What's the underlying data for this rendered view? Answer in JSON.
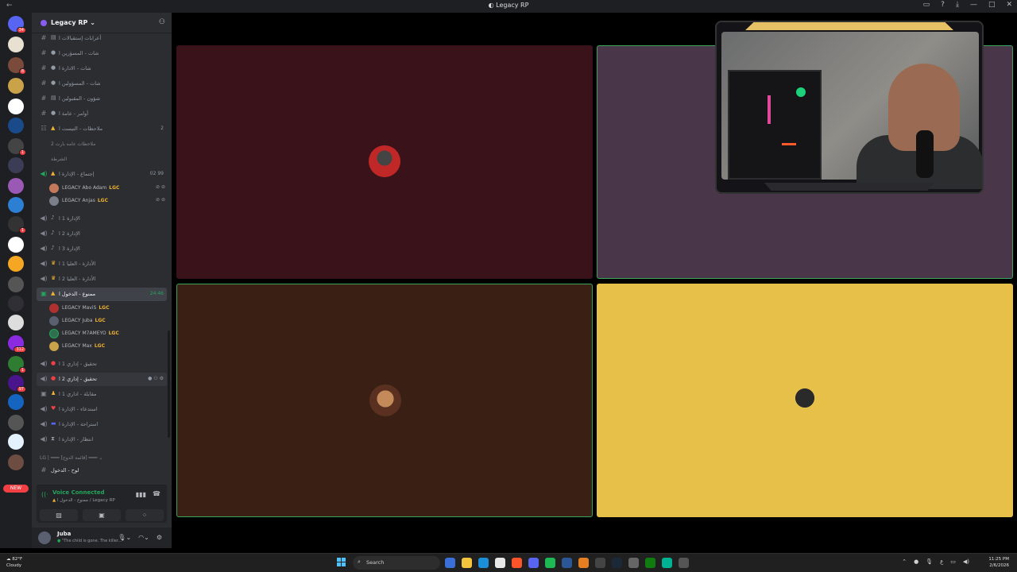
{
  "window": {
    "title": "Legacy RP"
  },
  "colors": {
    "rail_bg": "#1e1f22",
    "sidebar_bg": "#2b2d31",
    "accent_green": "#23a55a",
    "tile_1": "#3a1219",
    "tile_2": "#4a3649",
    "tile_3": "#3a1f14",
    "tile_4": "#e6c049",
    "speaking_border": "#3ba55c"
  },
  "server": {
    "name": "Legacy RP",
    "add_people_icon": "person-add-icon"
  },
  "rail_badges": [
    "34",
    "8",
    "1",
    "1",
    "4",
    "1",
    "312",
    "2",
    "1",
    "97"
  ],
  "new_label": "NEW",
  "channels": [
    {
      "label": "أعرابات إستقبالات ا",
      "icon": "hashtag-icon"
    },
    {
      "label": "شات - المسؤرين ا",
      "icon": "hashtag-icon"
    },
    {
      "label": "شات - الادارة ا",
      "icon": "hashtag-icon"
    },
    {
      "label": "شات - المسؤولين ا",
      "icon": "hashtag-icon"
    },
    {
      "label": "شؤون - المقبولين ا",
      "icon": "hashtag-icon"
    },
    {
      "label": "أوامر - عامة ا",
      "icon": "hashtag-icon"
    },
    {
      "label": "ملاحظات - التيست ا",
      "icon": "forum-icon",
      "count": "2"
    }
  ],
  "threads": [
    "ملاحظات عامه بارت 2",
    "الشرطة"
  ],
  "meeting_channel": {
    "label": "إجتماع - الإدارة ا",
    "badges": [
      "02",
      "99"
    ]
  },
  "meeting_users": [
    {
      "name": "Abo Adam",
      "prefix": "LEGACY",
      "tag": "LGC"
    },
    {
      "name": "Anjas",
      "prefix": "LEGACY",
      "tag": "LGC"
    }
  ],
  "voice_channels": [
    {
      "label": "الإدارة 1 ا"
    },
    {
      "label": "الإدارة 2 ا"
    },
    {
      "label": "الإدارة 3 ا"
    },
    {
      "label": "الأدارة - العليا 1 ا"
    },
    {
      "label": "الأدارة - العليا 2 ا"
    }
  ],
  "active_channel": {
    "label": "ممنوع - الدخول ا",
    "timer": "24:46"
  },
  "active_users": [
    {
      "name": "MaviS",
      "prefix": "LEGACY",
      "tag": "LGC"
    },
    {
      "name": "Juba",
      "prefix": "LEGACY",
      "tag": "LGC"
    },
    {
      "name": "M7AMEYO",
      "prefix": "LEGACY",
      "tag": "LGC"
    },
    {
      "name": "Max",
      "prefix": "LEGACY",
      "tag": "LGC"
    }
  ],
  "more_channels": [
    {
      "label": "تحقيق - إداري 1 ا"
    },
    {
      "label": "تحقيق - إداري 2 ا"
    },
    {
      "label": "مقابلة - اداري 1 ا"
    },
    {
      "label": "استدعاء - الإدارة ا"
    },
    {
      "label": "استراحة - الإدارة ا"
    },
    {
      "label": "انتظار - الإدارة ا"
    }
  ],
  "category": {
    "label": "LG | ━━━ [قائمة الدوج] ━━━"
  },
  "last_channel": {
    "label": "لوح - الدخول"
  },
  "voice_panel": {
    "status": "Voice Connected",
    "location": "ممنوع - الدخول ا / Legacy RP"
  },
  "user_panel": {
    "name": "Juba",
    "status": "\"The child is gone. The killer..."
  },
  "taskbar": {
    "temp": "82°F",
    "weather": "Cloudy",
    "search": "Search",
    "time": "11:25 PM",
    "date": "2/6/2026"
  }
}
